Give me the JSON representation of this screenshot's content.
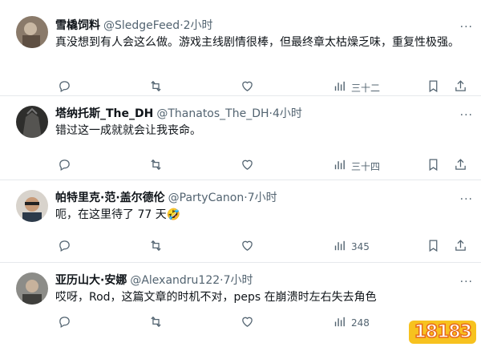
{
  "posts": [
    {
      "name": "雪橇饲料",
      "handle": "@SledgeFeed",
      "sep": "·",
      "time": "2小时",
      "text": "真没想到有人会这么做。游戏主线剧情很棒，但最终章太枯燥乏味，重复性极强。",
      "views": "三十二",
      "avatar_color": "#8a7a6a"
    },
    {
      "name": "塔纳托斯_The_DH",
      "handle": "@Thanatos_The_DH",
      "sep": "·",
      "time": "4小时",
      "text": "错过这一成就就会让我丧命。",
      "views": "三十四",
      "avatar_color": "#3a3a38"
    },
    {
      "name": "帕特里克·范·盖尔德伦",
      "handle": "@PartyCanon",
      "sep": "·",
      "time": "7小时",
      "text": "呃，在这里待了 77 天🤣",
      "views": "345",
      "avatar_color": "#b9a08a"
    },
    {
      "name": "亚历山大·安娜",
      "handle": "@Alexandru122",
      "sep": "·",
      "time": "7小时",
      "text": "哎呀，Rod，这篇文章的时机不对，peps 在崩溃时左右失去角色",
      "views": "248",
      "avatar_color": "#6b6b68"
    }
  ],
  "more_glyph": "···",
  "watermark": "18183",
  "icons": [
    "reply-icon",
    "repost-icon",
    "like-icon",
    "views-icon",
    "bookmark-icon",
    "share-icon"
  ],
  "colors": {
    "muted": "#536471",
    "text": "#0f1419",
    "divider": "#e6e9ec"
  }
}
